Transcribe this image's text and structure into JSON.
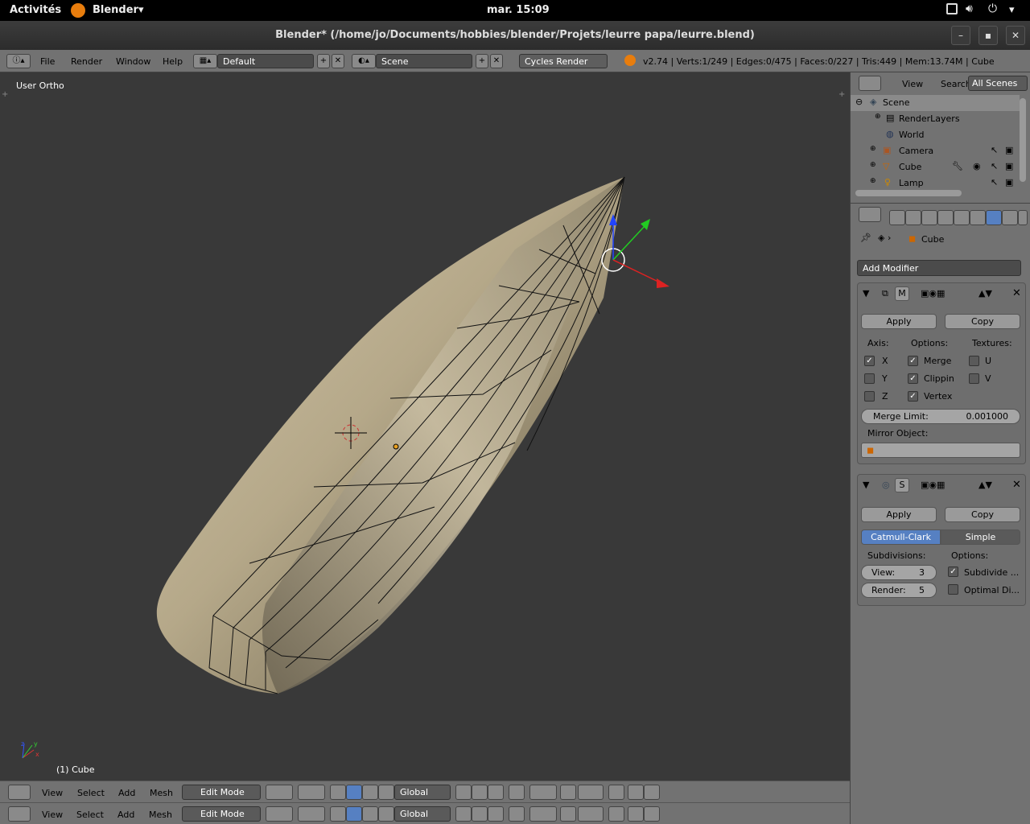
{
  "topbar": {
    "activities": "Activités",
    "app_name": "Blender",
    "clock": "mar. 15:09"
  },
  "window": {
    "title": "Blender* (/home/jo/Documents/hobbies/blender/Projets/leurre papa/leurre.blend)"
  },
  "info_header": {
    "menus": [
      "File",
      "Render",
      "Window",
      "Help"
    ],
    "screen_layout": "Default",
    "scene": "Scene",
    "render_engine": "Cycles Render",
    "stats": "v2.74 | Verts:1/249 | Edges:0/475 | Faces:0/227 | Tris:449 | Mem:13.74M | Cube"
  },
  "viewport": {
    "view_name": "User Ortho",
    "object_label": "(1) Cube",
    "axis_x": "x",
    "axis_y": "y",
    "axis_z": "z"
  },
  "view3d_header": {
    "menus": [
      "View",
      "Select",
      "Add",
      "Mesh"
    ],
    "mode": "Edit Mode",
    "orientation": "Global"
  },
  "outliner": {
    "menus": [
      "View",
      "Search"
    ],
    "filter": "All Scenes",
    "items": [
      "Scene",
      "RenderLayers",
      "World",
      "Camera",
      "Cube",
      "Lamp"
    ]
  },
  "properties": {
    "context_object": "Cube",
    "add_modifier": "Add Modifier",
    "mirror": {
      "short_name": "M",
      "apply": "Apply",
      "copy": "Copy",
      "axis_label": "Axis:",
      "options_label": "Options:",
      "textures_label": "Textures:",
      "axes": [
        "X",
        "Y",
        "Z"
      ],
      "axes_checked": [
        true,
        false,
        false
      ],
      "options": [
        "Merge",
        "Clippin",
        "Vertex"
      ],
      "options_checked": [
        true,
        true,
        true
      ],
      "textures": [
        "U",
        "V"
      ],
      "textures_checked": [
        false,
        false
      ],
      "merge_limit_label": "Merge Limit:",
      "merge_limit_value": "0.001000",
      "mirror_object_label": "Mirror Object:"
    },
    "subsurf": {
      "short_name": "S",
      "apply": "Apply",
      "copy": "Copy",
      "tabs": [
        "Catmull-Clark",
        "Simple"
      ],
      "subdivisions_label": "Subdivisions:",
      "options_label": "Options:",
      "view_label": "View:",
      "view_value": "3",
      "render_label": "Render:",
      "render_value": "5",
      "opt1": "Subdivide ...",
      "opt1_checked": true,
      "opt2": "Optimal Di...",
      "opt2_checked": false
    }
  },
  "colors": {
    "accent": "#5680c2",
    "header": "#727272",
    "viewport": "#393939",
    "mesh": "#c2b69a"
  }
}
